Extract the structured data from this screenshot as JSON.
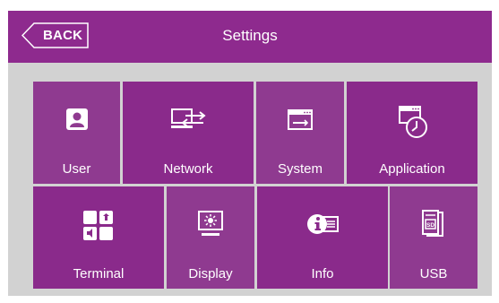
{
  "header": {
    "back_label": "BACK",
    "title": "Settings"
  },
  "tiles": [
    {
      "label": "User",
      "icon": "user-icon"
    },
    {
      "label": "Network",
      "icon": "network-icon"
    },
    {
      "label": "System",
      "icon": "system-icon"
    },
    {
      "label": "Application",
      "icon": "application-icon"
    },
    {
      "label": "Terminal",
      "icon": "terminal-icon"
    },
    {
      "label": "Display",
      "icon": "display-icon"
    },
    {
      "label": "Info",
      "icon": "info-icon"
    },
    {
      "label": "USB",
      "icon": "usb-icon"
    }
  ],
  "colors": {
    "header": "#8e2a8e",
    "tile": "#8a2a8b",
    "tile_alt": "#8f3a90",
    "panel": "#d2d2d2"
  }
}
